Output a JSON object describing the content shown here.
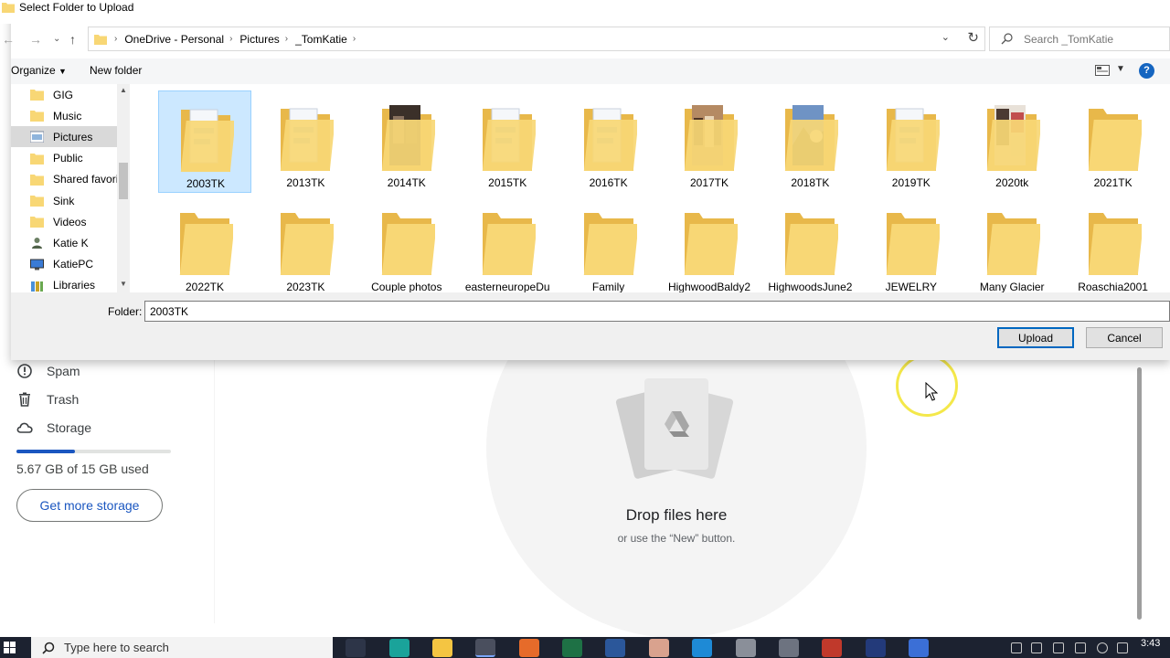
{
  "dialog": {
    "title": "Select Folder to Upload",
    "breadcrumb": [
      "OneDrive - Personal",
      "Pictures",
      "_TomKatie"
    ],
    "search_placeholder": "Search _TomKatie",
    "toolbar": {
      "organize": "Organize",
      "new_folder": "New folder"
    },
    "nav_items": [
      {
        "label": "GIG",
        "icon": "folder-icon"
      },
      {
        "label": "Music",
        "icon": "folder-icon"
      },
      {
        "label": "Pictures",
        "icon": "pictures-folder-icon",
        "selected": true
      },
      {
        "label": "Public",
        "icon": "folder-icon"
      },
      {
        "label": "Shared favorite",
        "icon": "folder-icon"
      },
      {
        "label": "Sink",
        "icon": "folder-icon"
      },
      {
        "label": "Videos",
        "icon": "folder-icon"
      },
      {
        "label": "Katie K",
        "icon": "user-icon"
      },
      {
        "label": "KatiePC",
        "icon": "computer-icon"
      },
      {
        "label": "Libraries",
        "icon": "libraries-icon"
      }
    ],
    "folders": [
      {
        "label": "2003TK",
        "selected": true,
        "thumb": "docs"
      },
      {
        "label": "2013TK",
        "thumb": "docs"
      },
      {
        "label": "2014TK",
        "thumb": "photo-dark"
      },
      {
        "label": "2015TK",
        "thumb": "docs"
      },
      {
        "label": "2016TK",
        "thumb": "docs"
      },
      {
        "label": "2017TK",
        "thumb": "photo-people"
      },
      {
        "label": "2018TK",
        "thumb": "photo-mountain"
      },
      {
        "label": "2019TK",
        "thumb": "docs"
      },
      {
        "label": "2020tk",
        "thumb": "photo-mixed"
      },
      {
        "label": "2021TK",
        "thumb": "empty"
      },
      {
        "label": "2022TK",
        "thumb": "empty"
      },
      {
        "label": "2023TK",
        "thumb": "empty"
      },
      {
        "label": "Couple photos",
        "thumb": "empty"
      },
      {
        "label": "easterneuropeDu",
        "thumb": "empty"
      },
      {
        "label": "Family",
        "thumb": "empty"
      },
      {
        "label": "HighwoodBaldy2",
        "thumb": "empty"
      },
      {
        "label": "HighwoodsJune2",
        "thumb": "empty"
      },
      {
        "label": "JEWELRY",
        "thumb": "empty"
      },
      {
        "label": "Many Glacier",
        "thumb": "empty"
      },
      {
        "label": "Roaschia2001",
        "thumb": "empty"
      }
    ],
    "folder_label": "Folder:",
    "folder_value": "2003TK",
    "upload_label": "Upload",
    "cancel_label": "Cancel"
  },
  "drive": {
    "sidebar": [
      {
        "label": "Spam",
        "icon": "spam-icon"
      },
      {
        "label": "Trash",
        "icon": "trash-icon"
      },
      {
        "label": "Storage",
        "icon": "cloud-icon"
      }
    ],
    "storage_text": "5.67 GB of 15 GB used",
    "storage_fraction": 0.378,
    "get_more_storage": "Get more storage",
    "drop_title": "Drop files here",
    "drop_subtitle": "or use the “New” button."
  },
  "taskbar": {
    "search_placeholder": "Type here to search",
    "clock": "3:43"
  },
  "colors": {
    "folder_yellow": "#f8d775",
    "selection": "#cce8ff",
    "accent": "#0067c0",
    "drive_blue": "#1a56c0",
    "taskbar": "#1c2230"
  }
}
